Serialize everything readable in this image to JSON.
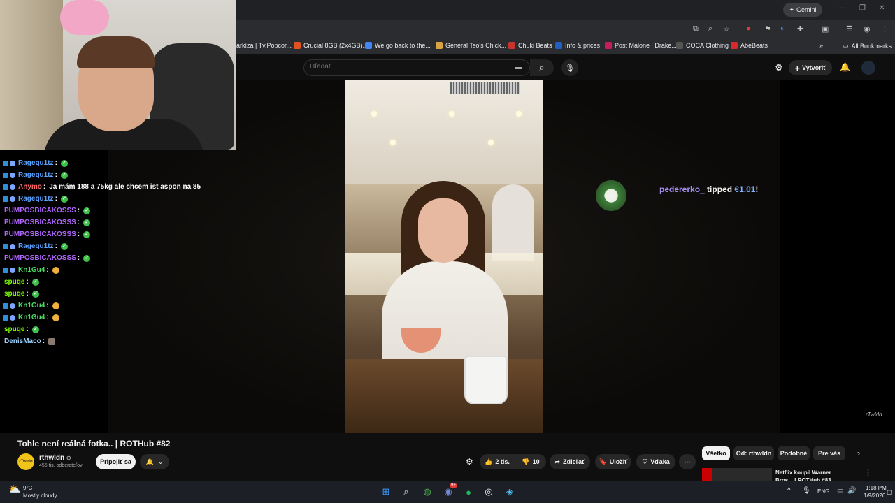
{
  "browser": {
    "gemini_label": "Gemini",
    "bookmarks": [
      {
        "label": "arkíza | Tv.Popcor...",
        "color": "#666"
      },
      {
        "label": "Crucial 8GB (2x4GB)...",
        "color": "#e0531f"
      },
      {
        "label": "We go back to the...",
        "color": "#4285f4"
      },
      {
        "label": "General Tso's Chick...",
        "color": "#d9a441"
      },
      {
        "label": "Chuki Beats",
        "color": "#c8342c"
      },
      {
        "label": "Info & prices",
        "color": "#1f5fbf"
      },
      {
        "label": "Post Malone | Drake...",
        "color": "#c81d5c"
      },
      {
        "label": "COCA Clothing",
        "color": "#222"
      },
      {
        "label": "AbeBeats",
        "color": "#d62a2a"
      }
    ],
    "all_bookmarks": "All Bookmarks"
  },
  "youtube": {
    "search_placeholder": "Hľadať",
    "create_label": "Vytvoriť"
  },
  "overlay": {
    "tip_user": "pedererko_",
    "tip_verb": "tipped",
    "tip_amount": "€1.01",
    "tip_end": "!",
    "watermark": "rTwldn"
  },
  "chat": [
    {
      "user": "Ragequ1tz",
      "color": "#5aa3ff",
      "message": "",
      "emote": "green",
      "badges": true
    },
    {
      "user": "Ragequ1tz",
      "color": "#5aa3ff",
      "message": "",
      "emote": "green",
      "badges": true
    },
    {
      "user": "Anymo",
      "color": "#ff6b6b",
      "message": "Ja mám 188 a 75kg ale chcem ist aspon na 85",
      "emote": "",
      "badges": true
    },
    {
      "user": "Ragequ1tz",
      "color": "#5aa3ff",
      "message": "",
      "emote": "green",
      "badges": true
    },
    {
      "user": "PUMPOSBICAKOSSS",
      "color": "#b266ff",
      "message": "",
      "emote": "green",
      "badges": false
    },
    {
      "user": "PUMPOSBICAKOSSS",
      "color": "#b266ff",
      "message": "",
      "emote": "green",
      "badges": false
    },
    {
      "user": "PUMPOSBICAKOSSS",
      "color": "#b266ff",
      "message": "",
      "emote": "green",
      "badges": false
    },
    {
      "user": "Ragequ1tz",
      "color": "#5aa3ff",
      "message": "",
      "emote": "green",
      "badges": true
    },
    {
      "user": "PUMPOSBICAKOSSS",
      "color": "#b266ff",
      "message": "",
      "emote": "green",
      "badges": false
    },
    {
      "user": "Kn1Gu4",
      "color": "#4cd964",
      "message": "",
      "emote": "face",
      "badges": true
    },
    {
      "user": "spuqe",
      "color": "#7cfc00",
      "message": "",
      "emote": "green",
      "badges": false
    },
    {
      "user": "spuqe",
      "color": "#7cfc00",
      "message": "",
      "emote": "green",
      "badges": false
    },
    {
      "user": "Kn1Gu4",
      "color": "#4cd964",
      "message": "",
      "emote": "face",
      "badges": true
    },
    {
      "user": "Kn1Gu4",
      "color": "#4cd964",
      "message": "",
      "emote": "face",
      "badges": true
    },
    {
      "user": "spuqe",
      "color": "#7cfc00",
      "message": "",
      "emote": "green",
      "badges": false
    },
    {
      "user": "DenisMaco",
      "color": "#9ad1ff",
      "message": "",
      "emote": "pic",
      "badges": false
    }
  ],
  "video": {
    "title": "Tohle není reálná fotka.. | ROTHub #82",
    "channel_name": "rthwldn",
    "avatar_text": "rTwldn",
    "subscribers": "455 tis. odberateľov",
    "join_label": "Pripojiť sa",
    "likes": "2 tis.",
    "dislikes": "10",
    "share_label": "Zdieľať",
    "save_label": "Uložiť",
    "thanks_label": "Vďaka"
  },
  "chips": [
    "Všetko",
    "Od: rthwldn",
    "Podobné",
    "Pre vás"
  ],
  "recommendation": {
    "title": "Netflix koupil Warner Bros... | ROTHub #83"
  },
  "taskbar": {
    "temperature": "9°C",
    "weather": "Mostly cloudy",
    "language": "ENG",
    "time": "1:18 PM",
    "date": "1/9/2026",
    "discord_badge": "9+"
  }
}
